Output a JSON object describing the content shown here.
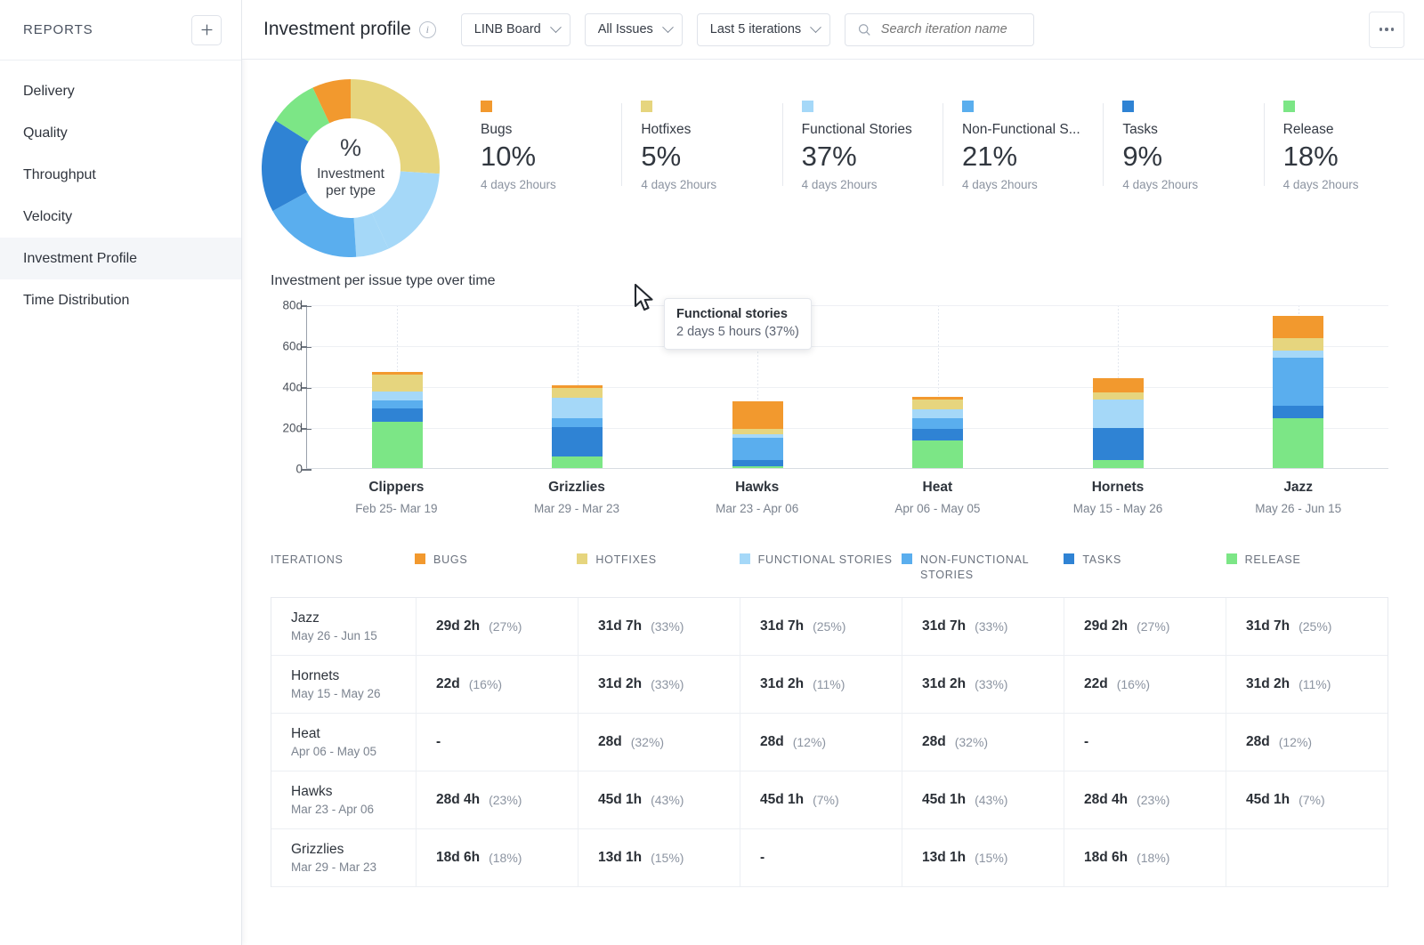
{
  "sidebar": {
    "title": "REPORTS",
    "add_label": "+",
    "items": [
      {
        "label": "Delivery",
        "active": false
      },
      {
        "label": "Quality",
        "active": false
      },
      {
        "label": "Throughput",
        "active": false
      },
      {
        "label": "Velocity",
        "active": false
      },
      {
        "label": "Investment Profile",
        "active": true
      },
      {
        "label": "Time Distribution",
        "active": false
      }
    ]
  },
  "topbar": {
    "title": "Investment profile",
    "info_icon": "info-icon",
    "board_select": "LINB Board",
    "issues_select": "All Issues",
    "iterations_select": "Last 5 iterations",
    "search_placeholder": "Search iteration name",
    "search_value": "",
    "more_label": "more-options"
  },
  "donut": {
    "center_symbol": "%",
    "center_line1": "Investment",
    "center_line2": "per type",
    "tooltip": {
      "title": "Functional stories",
      "duration": "2 days 5 hours",
      "percent": "(37%)"
    }
  },
  "stats": [
    {
      "name": "Bugs",
      "value": "10%",
      "sub": "4 days 2hours",
      "color": "#f2992e"
    },
    {
      "name": "Hotfixes",
      "value": "5%",
      "sub": "4 days 2hours",
      "color": "#e6d57e"
    },
    {
      "name": "Functional Stories",
      "value": "37%",
      "sub": "4 days 2hours",
      "color": "#a5d8f8"
    },
    {
      "name": "Non-Functional S...",
      "value": "21%",
      "sub": "4 days 2hours",
      "color": "#5aaeee"
    },
    {
      "name": "Tasks",
      "value": "9%",
      "sub": "4 days 2hours",
      "color": "#2f83d4"
    },
    {
      "name": "Release",
      "value": "18%",
      "sub": "4 days 2hours",
      "color": "#7ce686"
    }
  ],
  "chart_data": {
    "type": "bar",
    "title": "Investment per issue type over time",
    "stacked": true,
    "xlabel": "",
    "ylabel": "",
    "ylim": [
      0,
      80
    ],
    "yticks": [
      "0",
      "20d",
      "40d",
      "60d",
      "80d"
    ],
    "ytick_values": [
      0,
      20,
      40,
      60,
      80
    ],
    "grid": true,
    "legend_position": "below-table-header",
    "categories": [
      "Clippers",
      "Grizzlies",
      "Hawks",
      "Heat",
      "Hornets",
      "Jazz"
    ],
    "category_ranges": [
      "Feb 25- Mar 19",
      "Mar 29 - Mar 23",
      "Mar 23 - Apr 06",
      "Apr 06 - May 05",
      "May 15 - May 26",
      "May 26 - Jun 15"
    ],
    "series": [
      {
        "name": "Release",
        "color": "#7ce686",
        "values": [
          22.5,
          5.5,
          1.0,
          13.5,
          4.0,
          24.5
        ]
      },
      {
        "name": "Tasks",
        "color": "#2f83d4",
        "values": [
          6.5,
          14.5,
          3.0,
          5.5,
          15.5,
          6.0
        ]
      },
      {
        "name": "Non-Functional Stories",
        "color": "#5aaeee",
        "values": [
          4.0,
          4.5,
          11.0,
          5.5,
          0.0,
          23.5
        ]
      },
      {
        "name": "Functional Stories",
        "color": "#a5d8f8",
        "values": [
          4.5,
          10.0,
          1.5,
          4.0,
          14.0,
          3.5
        ]
      },
      {
        "name": "Hotfixes",
        "color": "#e6d57e",
        "values": [
          8.0,
          4.5,
          2.5,
          5.0,
          3.5,
          6.0
        ]
      },
      {
        "name": "Bugs",
        "color": "#f2992e",
        "values": [
          1.5,
          1.5,
          13.5,
          1.5,
          7.0,
          11.0
        ]
      }
    ]
  },
  "table": {
    "columns": [
      {
        "label": "ITERATIONS",
        "color": null
      },
      {
        "label": "BUGS",
        "color": "#f2992e"
      },
      {
        "label": "HOTFIXES",
        "color": "#e6d57e"
      },
      {
        "label": "FUNCTIONAL STORIES",
        "color": "#a5d8f8"
      },
      {
        "label": "NON-FUNCTIONAL STORIES",
        "color": "#5aaeee"
      },
      {
        "label": "TASKS",
        "color": "#2f83d4"
      },
      {
        "label": "RELEASE",
        "color": "#7ce686"
      }
    ],
    "rows": [
      {
        "name": "Jazz",
        "range": "May 26 - Jun 15",
        "cells": [
          {
            "value": "29d 2h",
            "pct": "(27%)"
          },
          {
            "value": "31d 7h",
            "pct": "(33%)"
          },
          {
            "value": "31d 7h",
            "pct": "(25%)"
          },
          {
            "value": "31d 7h",
            "pct": "(33%)"
          },
          {
            "value": "29d 2h",
            "pct": "(27%)"
          },
          {
            "value": "31d 7h",
            "pct": "(25%)"
          }
        ]
      },
      {
        "name": "Hornets",
        "range": "May 15 - May 26",
        "cells": [
          {
            "value": "22d",
            "pct": "(16%)"
          },
          {
            "value": "31d 2h",
            "pct": "(33%)"
          },
          {
            "value": "31d 2h",
            "pct": "(11%)"
          },
          {
            "value": "31d 2h",
            "pct": "(33%)"
          },
          {
            "value": "22d",
            "pct": "(16%)"
          },
          {
            "value": "31d 2h",
            "pct": "(11%)"
          }
        ]
      },
      {
        "name": "Heat",
        "range": "Apr 06 - May 05",
        "cells": [
          {
            "value": "-",
            "pct": ""
          },
          {
            "value": "28d",
            "pct": "(32%)"
          },
          {
            "value": "28d",
            "pct": "(12%)"
          },
          {
            "value": "28d",
            "pct": "(32%)"
          },
          {
            "value": "-",
            "pct": ""
          },
          {
            "value": "28d",
            "pct": "(12%)"
          }
        ]
      },
      {
        "name": "Hawks",
        "range": "Mar 23 - Apr 06",
        "cells": [
          {
            "value": "28d 4h",
            "pct": "(23%)"
          },
          {
            "value": "45d 1h",
            "pct": "(43%)"
          },
          {
            "value": "45d 1h",
            "pct": "(7%)"
          },
          {
            "value": "45d 1h",
            "pct": "(43%)"
          },
          {
            "value": "28d 4h",
            "pct": "(23%)"
          },
          {
            "value": "45d 1h",
            "pct": "(7%)"
          }
        ]
      },
      {
        "name": "Grizzlies",
        "range": "Mar 29 - Mar 23",
        "cells": [
          {
            "value": "18d 6h",
            "pct": "(18%)"
          },
          {
            "value": "13d 1h",
            "pct": "(15%)"
          },
          {
            "value": "-",
            "pct": ""
          },
          {
            "value": "13d 1h",
            "pct": "(15%)"
          },
          {
            "value": "18d 6h",
            "pct": "(18%)"
          },
          {
            "value": "",
            "pct": ""
          }
        ]
      }
    ]
  }
}
